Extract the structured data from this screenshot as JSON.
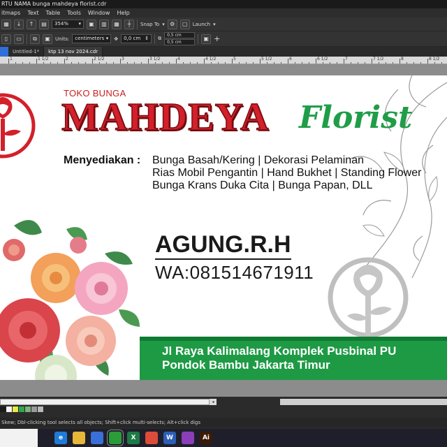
{
  "window": {
    "title": "RTU NAMA  bunga mahdeya florist.cdr"
  },
  "menu": [
    "itmaps",
    "Text",
    "Table",
    "Tools",
    "Window",
    "Help"
  ],
  "toolbar1": {
    "zoom": "354%",
    "snap_label": "Snap To",
    "launch_label": "Launch"
  },
  "toolbar2": {
    "units_label": "Units:",
    "units_value": "centimeters",
    "nudge": "0,0 cm",
    "dup_x": "0,5 cm",
    "dup_y": "0,5 cm"
  },
  "tabs": [
    {
      "label": "Untitled-1*"
    },
    {
      "label": "ktp 13 nov 2024.cdr"
    }
  ],
  "ruler": {
    "labels": [
      "1",
      "1 1/2",
      "2",
      "2 1/2",
      "3",
      "3 1/2",
      "4",
      "4 1/2",
      "5",
      "5 1/2",
      "6",
      "6 1/2",
      "7",
      "7 1/2",
      "8",
      "8 1/2"
    ]
  },
  "card": {
    "toko": "TOKO BUNGA",
    "brand": "MAHDEYA",
    "florist": "Florist",
    "menyediakan": "Menyediakan :",
    "services": [
      "Bunga Basah/Kering | Dekorasi Pelaminan",
      "Rias Mobil Pengantin | Hand Bukhet | Standing Flower",
      "Bunga Krans Duka Cita | Bunga Papan, DLL"
    ],
    "name": "AGUNG.R.H",
    "wa": "WA:081514671911",
    "address": [
      "Jl Raya Kalimalang Komplek Pusbinal PU",
      "Pondok Bambu Jakarta Timur"
    ]
  },
  "colors": {
    "brand_red": "#d3202a",
    "brand_green": "#1f9d48",
    "band_green": "#1e9a45"
  },
  "status": {
    "text": "Skew; Dbl-clicking tool selects all objects; Shift+click multi-selects; Alt+click digs"
  },
  "taskbar": [
    {
      "name": "edge",
      "glyph": "e",
      "color": "#1f7bd8"
    },
    {
      "name": "file-explorer",
      "glyph": "",
      "color": "#e7b53a"
    },
    {
      "name": "store",
      "glyph": "",
      "color": "#3a6fd8"
    },
    {
      "name": "coreldraw",
      "glyph": "",
      "color": "#2a9d3a"
    },
    {
      "name": "excel",
      "glyph": "X",
      "color": "#1d7a45"
    },
    {
      "name": "chrome",
      "glyph": "",
      "color": "#dd4b39"
    },
    {
      "name": "word",
      "glyph": "W",
      "color": "#2b5fb8"
    },
    {
      "name": "app-purple",
      "glyph": "",
      "color": "#8a3fb8"
    },
    {
      "name": "illustrator",
      "glyph": "Ai",
      "color": "#3a1a08"
    }
  ]
}
